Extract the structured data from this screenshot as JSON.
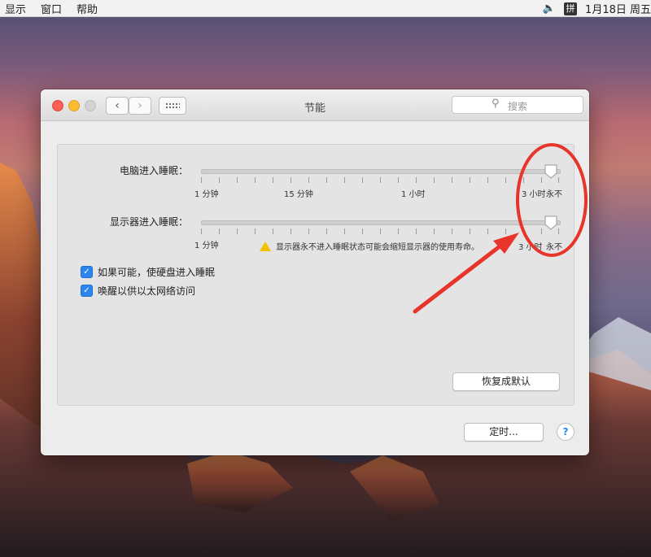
{
  "menubar": {
    "items": [
      "显示",
      "窗口",
      "帮助"
    ],
    "ime_badge": "拼",
    "clock": "1月18日 周五"
  },
  "window": {
    "title": "节能",
    "search_placeholder": "搜索"
  },
  "computer_sleep": {
    "label": "电脑进入睡眠：",
    "ticks": [
      "1 分钟",
      "15 分钟",
      "1 小时",
      "3 小时",
      "永不"
    ],
    "value": "永不"
  },
  "display_sleep": {
    "label": "显示器进入睡眠：",
    "ticks": [
      "1 分钟",
      "3 小时",
      "永不"
    ],
    "value": "永不",
    "warning": "显示器永不进入睡眠状态可能会缩短显示器的使用寿命。"
  },
  "options": [
    {
      "label": "如果可能，使硬盘进入睡眠",
      "checked": true
    },
    {
      "label": "唤醒以供以太网络访问",
      "checked": true
    }
  ],
  "buttons": {
    "restore_defaults": "恢复成默认",
    "schedule": "定时...",
    "help": "?"
  },
  "colors": {
    "annotation": "#e8352b",
    "accent": "#2d86f0"
  }
}
